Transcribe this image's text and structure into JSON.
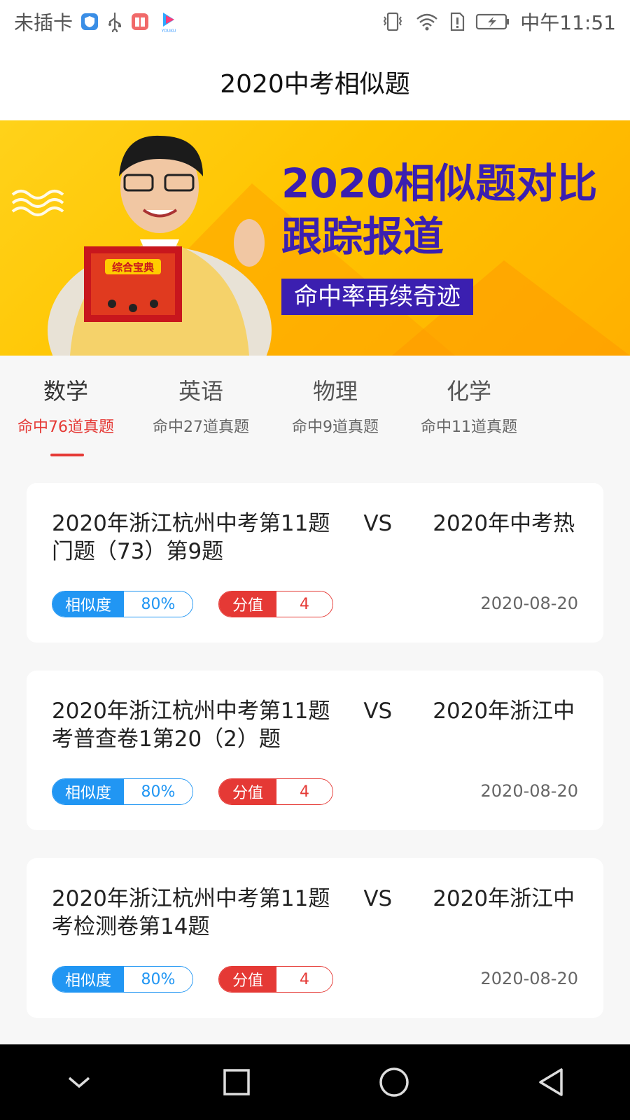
{
  "status_bar": {
    "carrier": "未插卡",
    "time": "中午11:51",
    "icons_left": [
      "shield-app-icon",
      "usb-icon",
      "book-app-icon",
      "youku-app-icon"
    ],
    "youku_text": "YOUKU",
    "icons_right": [
      "vibrate-icon",
      "wifi-icon",
      "alert-icon",
      "battery-charging-icon"
    ]
  },
  "header": {
    "title": "2020中考相似题"
  },
  "banner": {
    "headline_line1": "2020相似题对比",
    "headline_line2": "跟踪报道",
    "subline": "命中率再续奇迹",
    "book_title": "综合宝典"
  },
  "tabs": [
    {
      "name": "数学",
      "hits": "命中76道真题",
      "active": true
    },
    {
      "name": "英语",
      "hits": "命中27道真题",
      "active": false
    },
    {
      "name": "物理",
      "hits": "命中9道真题",
      "active": false
    },
    {
      "name": "化学",
      "hits": "命中11道真题",
      "active": false
    }
  ],
  "cards": [
    {
      "left": "2020年浙江杭州中考第11题",
      "vs": "VS",
      "right": "2020年中考热门题（73）第9题",
      "similarity_label": "相似度",
      "similarity": "80%",
      "score_label": "分值",
      "score": "4",
      "date": "2020-08-20"
    },
    {
      "left": "2020年浙江杭州中考第11题",
      "vs": "VS",
      "right": "2020年浙江中考普查卷1第20（2）题",
      "similarity_label": "相似度",
      "similarity": "80%",
      "score_label": "分值",
      "score": "4",
      "date": "2020-08-20"
    },
    {
      "left": "2020年浙江杭州中考第11题",
      "vs": "VS",
      "right": "2020年浙江中考检测卷第14题",
      "similarity_label": "相似度",
      "similarity": "80%",
      "score_label": "分值",
      "score": "4",
      "date": "2020-08-20"
    }
  ],
  "nav": [
    "collapse-icon",
    "recents-icon",
    "home-icon",
    "back-icon"
  ],
  "colors": {
    "accent_red": "#e53935",
    "accent_blue": "#2196f3",
    "banner_purple": "#3b1fb0",
    "banner_yellow": "#ffc400"
  }
}
